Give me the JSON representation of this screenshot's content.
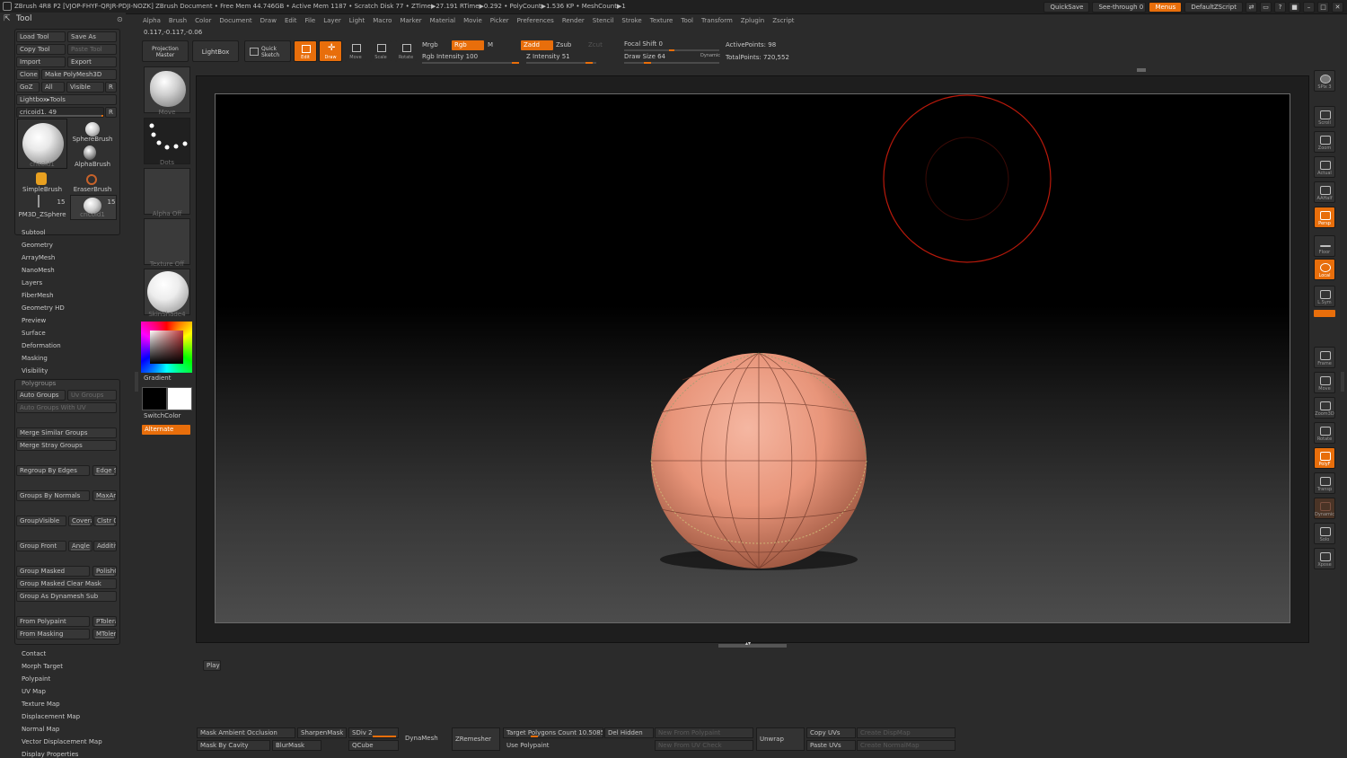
{
  "titlebar": {
    "title": "ZBrush 4R8 P2 [VJOP-FHYF-QRJR-PDJI-NOZK]   ZBrush Document     • Free Mem 44.746GB • Active Mem 1187 • Scratch Disk 77 • ZTime▶27.191 RTime▶0.292 • PolyCount▶1.536 KP • MeshCount▶1",
    "quicksave": "QuickSave",
    "seethrough": "See-through  0",
    "menus": "Menus",
    "zscript": "DefaultZScript"
  },
  "menu": [
    "Alpha",
    "Brush",
    "Color",
    "Document",
    "Draw",
    "Edit",
    "File",
    "Layer",
    "Light",
    "Macro",
    "Marker",
    "Material",
    "Movie",
    "Picker",
    "Preferences",
    "Render",
    "Stencil",
    "Stroke",
    "Texture",
    "Tool",
    "Transform",
    "Zplugin",
    "Zscript"
  ],
  "coords": "0.117,-0.117,-0.06",
  "tool": {
    "title": "Tool",
    "load": "Load Tool",
    "save_as": "Save As",
    "copy": "Copy Tool",
    "paste": "Paste Tool",
    "import": "Import",
    "export": "Export",
    "clone": "Clone",
    "make_poly": "Make PolyMesh3D",
    "goz": "GoZ",
    "all": "All",
    "visible": "Visible",
    "r": "R",
    "lightbox_tools": "Lightbox▸Tools",
    "current": "cricoid1. 49",
    "r2": "R",
    "thumb_main": "cricoid1",
    "sphere_brush": "SphereBrush",
    "alpha_brush": "AlphaBrush",
    "simple_brush": "SimpleBrush",
    "eraser_brush": "EraserBrush",
    "count1": "15",
    "count2": "15",
    "pm3d": "PM3D_ZSphere",
    "cricoid_small": "cricoid1",
    "sections": [
      "Subtool",
      "Geometry",
      "ArrayMesh",
      "NanoMesh",
      "Layers",
      "FiberMesh",
      "Geometry HD",
      "Preview",
      "Surface",
      "Deformation",
      "Masking",
      "Visibility"
    ],
    "polygroups": "Polygroups",
    "auto_groups": "Auto Groups",
    "uv_groups": "Uv Groups",
    "auto_groups_uv": "Auto Groups With UV",
    "merge_similar": "Merge Similar Groups",
    "merge_stray": "Merge Stray Groups",
    "regroup_edges": "Regroup By Edges",
    "edge_s": "Edge Sc",
    "groups_normals": "Groups By Normals",
    "maxang": "MaxAng",
    "group_visible": "GroupVisible",
    "coverage": "Covera",
    "clstr": "Clstr 0",
    "group_front": "Group Front",
    "angle": "Angle",
    "additive": "Additive",
    "group_masked": "Group Masked",
    "polishg": "PolishG",
    "group_masked_clear": "Group Masked Clear Mask",
    "group_dynamesh": "Group As Dynamesh Sub",
    "from_polypaint": "From Polypaint",
    "ptolera": "PTolera",
    "from_masking": "From Masking",
    "mtoler": "MToler",
    "sections2": [
      "Contact",
      "Morph Target",
      "Polypaint",
      "UV Map",
      "Texture Map",
      "Displacement Map",
      "Normal Map",
      "Vector Displacement Map",
      "Display Properties"
    ]
  },
  "col2": {
    "move": "Move",
    "dots": "Dots",
    "alpha_off": "Alpha Off",
    "texture_off": "Texture Off",
    "skin_shade": "SkinShade4",
    "gradient": "Gradient",
    "switch_color": "SwitchColor",
    "alternate": "Alternate"
  },
  "shelf": {
    "projection": "Projection Master",
    "lightbox": "LightBox",
    "quick_sketch": "Quick Sketch",
    "edit": "Edit",
    "draw": "Draw",
    "move": "Move",
    "scale": "Scale",
    "rotate": "Rotate",
    "mrgb": "Mrgb",
    "rgb": "Rgb",
    "m": "M",
    "rgb_intensity": "Rgb Intensity 100",
    "zadd": "Zadd",
    "zsub": "Zsub",
    "zcut": "Zcut",
    "z_intensity": "Z Intensity 51",
    "focal_shift": "Focal Shift 0",
    "draw_size": "Draw Size 64",
    "dynamic": "Dynamic",
    "active_points": "ActivePoints: 98",
    "total_points": "TotalPoints: 720,552"
  },
  "right_shelf": [
    "SPix 3",
    "Scroll",
    "Zoom",
    "Actual",
    "AAHalf",
    "Persp",
    "Floor",
    "Local",
    "L.Sym",
    "Frame",
    "Move",
    "Zoom3D",
    "Rotate",
    "PolyF",
    "Transp",
    "Dynamic",
    "Solo",
    "Xpose"
  ],
  "play": "Play",
  "bottom": {
    "mask_ao": "Mask Ambient Occlusion",
    "sharpen_mask": "SharpenMask",
    "sdiv": "SDiv 2",
    "dynamesh": "DynaMesh",
    "zremesher": "ZRemesher",
    "target_polys": "Target Polygons Count 10.50858",
    "del_hidden": "Del Hidden",
    "new_from_polypaint": "New From Polypaint",
    "unwrap": "Unwrap",
    "copy_uvs": "Copy UVs",
    "create_dispmap": "Create DispMap",
    "mask_cavity": "Mask By Cavity",
    "blur_mask": "BlurMask",
    "qcube": "QCube",
    "use_polypaint": "Use Polypaint",
    "new_from_uv": "New From UV Check",
    "paste_uvs": "Paste UVs",
    "create_normalmap": "Create NormalMap"
  },
  "colors": {
    "accent": "#e86e0b",
    "sphere": "#e8957a"
  }
}
